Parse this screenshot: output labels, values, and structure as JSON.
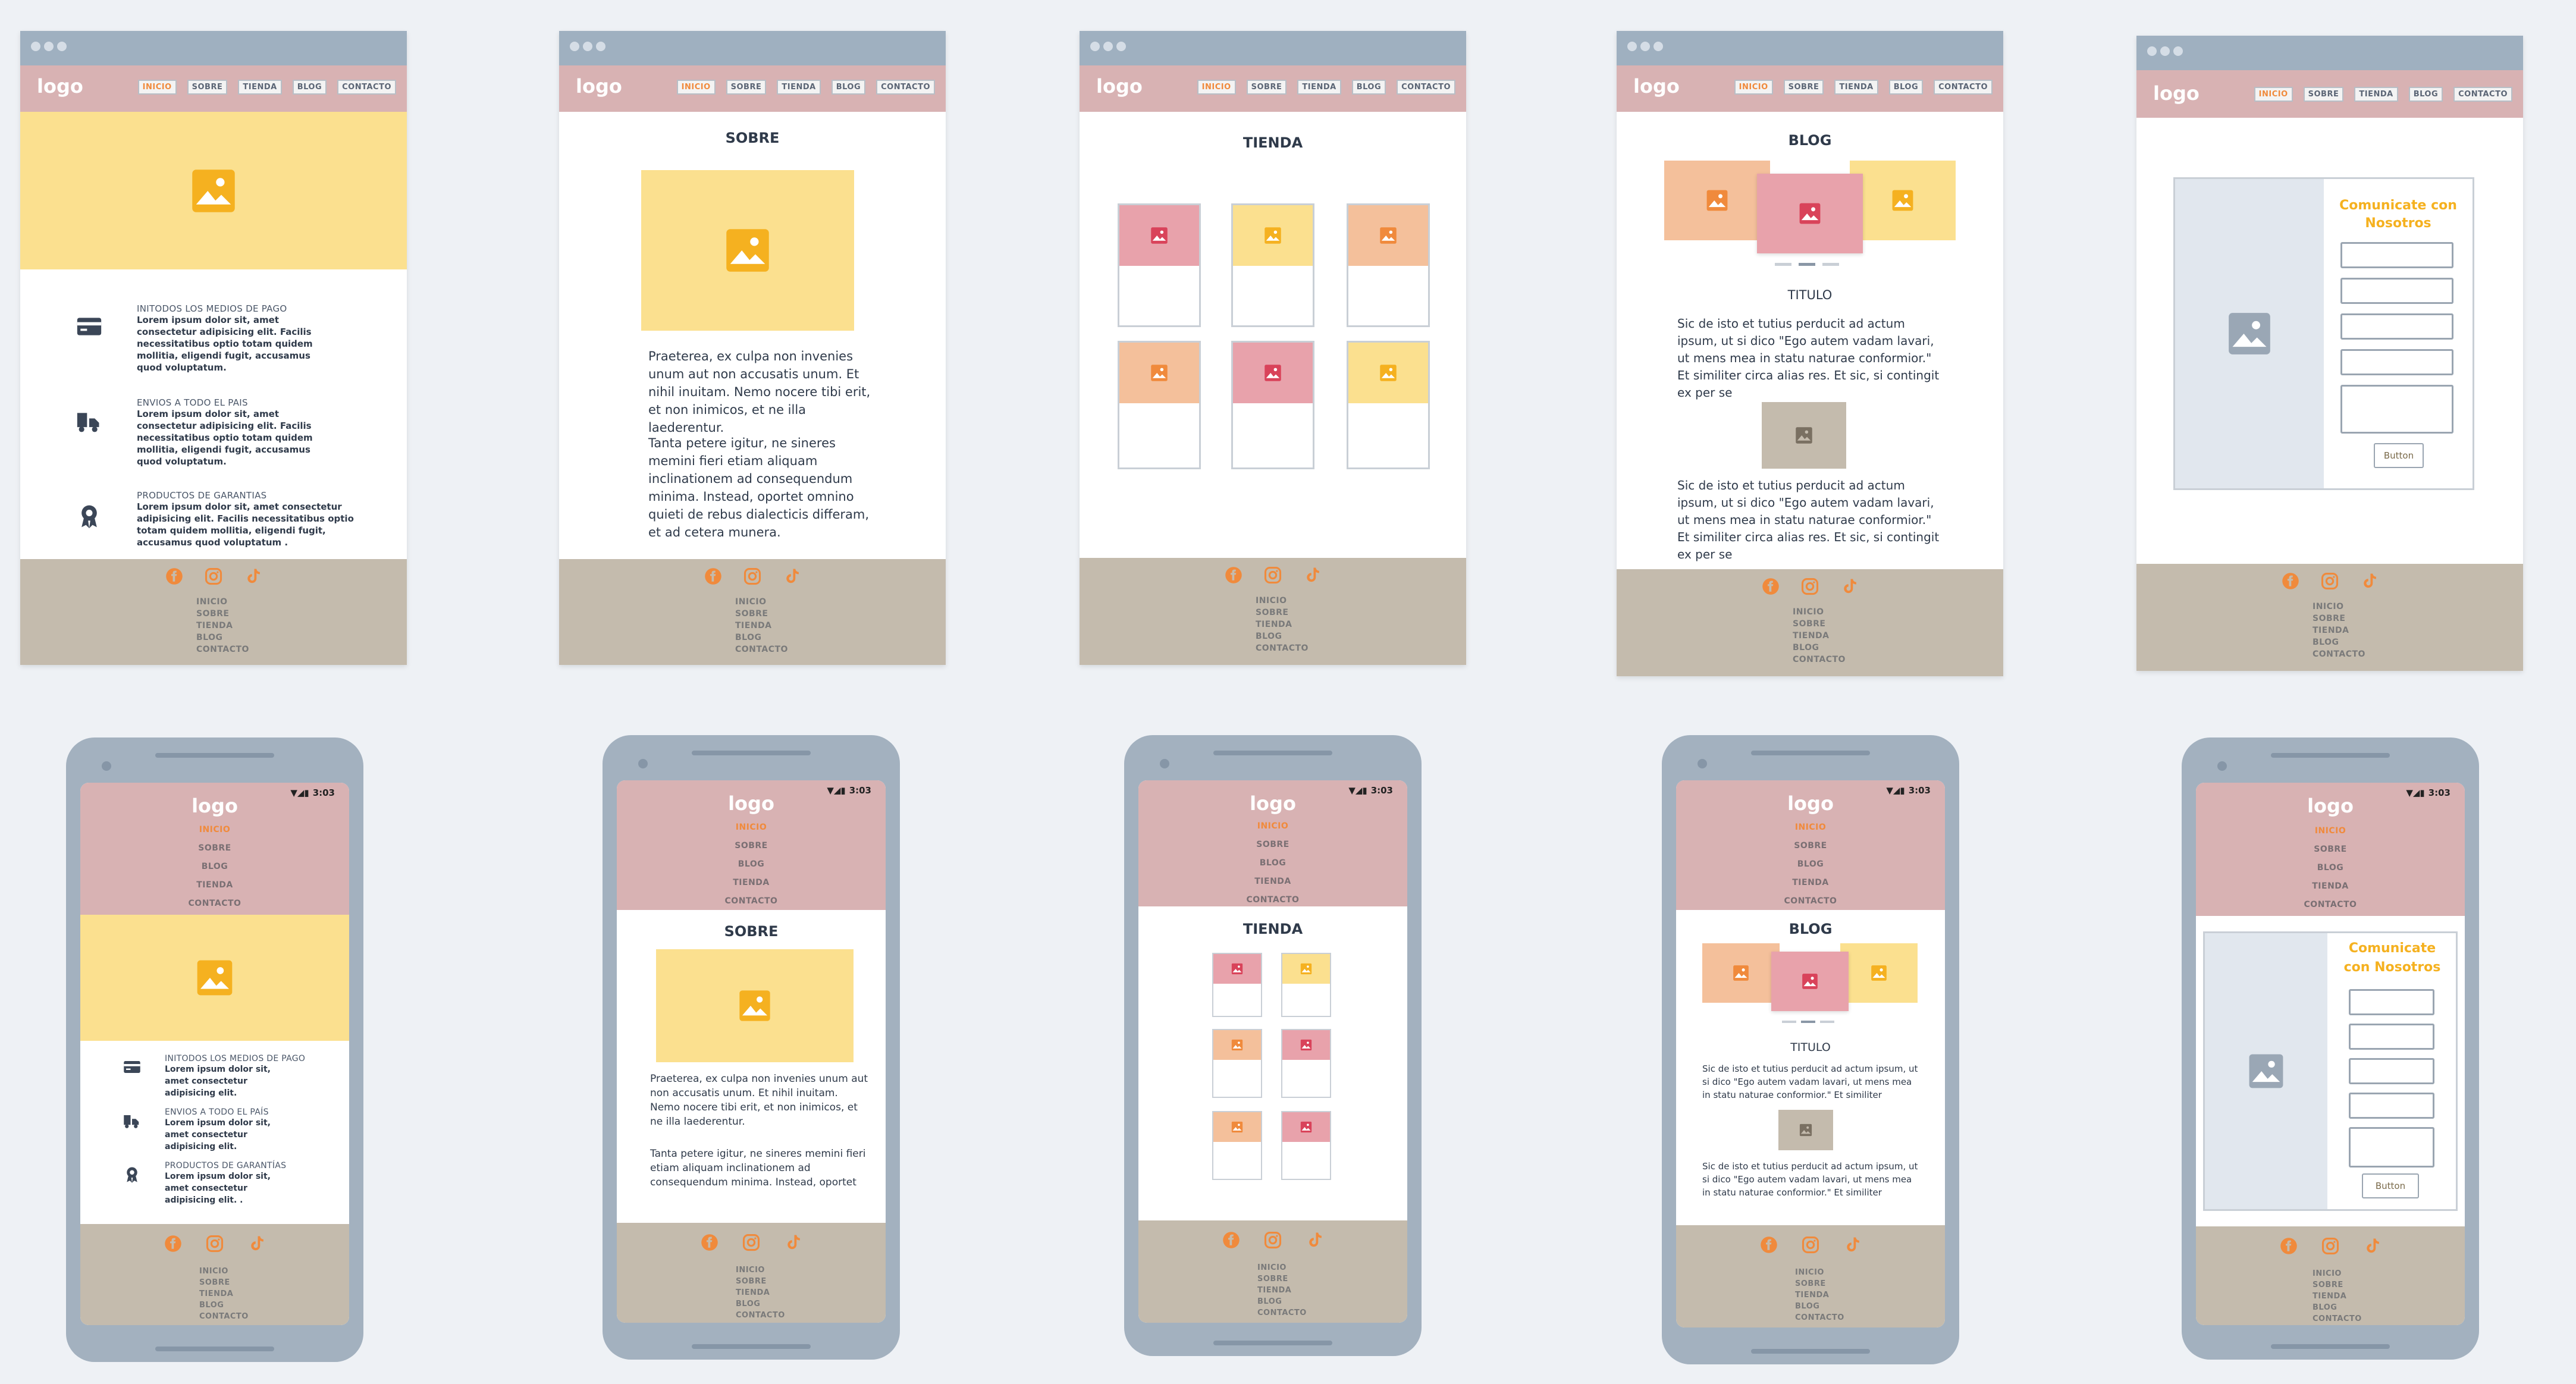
{
  "logo": "logo",
  "nav_desktop": [
    "INICIO",
    "SOBRE",
    "TIENDA",
    "BLOG",
    "CONTACTO"
  ],
  "nav_mobile": [
    "INICIO",
    "SOBRE",
    "BLOG",
    "TIENDA",
    "CONTACTO"
  ],
  "footer_links": [
    "INICIO",
    "SOBRE",
    "TIENDA",
    "BLOG",
    "CONTACTO"
  ],
  "status_time": "3:03",
  "colors": {
    "header": "#d8b2b3",
    "footer": "#c4bbad",
    "accent": "#f08a3c",
    "hero": "#fbe08f",
    "pink": "#e8a2ab",
    "peach": "#f4c09b",
    "yellow": "#fbe08f",
    "gray_photo": "#c4bbad",
    "contact_image": "#e1e7ee",
    "contact_title": "#f5b120",
    "frame": "#9fb0c0"
  },
  "icons": [
    "facebook-icon",
    "instagram-icon",
    "tiktok-icon",
    "image-icon",
    "credit-card-icon",
    "truck-icon",
    "award-icon"
  ],
  "home": {
    "features": [
      {
        "title": "INITODOS LOS MEDIOS DE PAGO",
        "text": "Lorem ipsum dolor sit, amet consectetur adipisicing elit. Facilis necessitatibus optio totam quidem mollitia, eligendi fugit, accusamus quod voluptatum."
      },
      {
        "title": "ENVIOS A TODO EL PAIS",
        "text": "Lorem ipsum dolor sit, amet consectetur adipisicing elit. Facilis necessitatibus optio totam quidem mollitia, eligendi fugit, accusamus quod voluptatum."
      },
      {
        "title": "PRODUCTOS DE GARANTIAS",
        "text": "Lorem ipsum dolor sit, amet consectetur adipisicing elit. Facilis necessitatibus optio totam quidem mollitia, eligendi fugit, accusamus quod voluptatum ."
      }
    ],
    "features_mobile": [
      {
        "title": "INITODOS LOS MEDIOS DE PAGO",
        "text": "Lorem ipsum dolor sit, amet consectetur adipisicing elit."
      },
      {
        "title": "ENVIOS A TODO EL PAÍS",
        "text": "Lorem ipsum dolor sit, amet consectetur adipisicing elit."
      },
      {
        "title": "PRODUCTOS DE GARANTÍAS",
        "text": "Lorem ipsum dolor sit, amet consectetur adipisicing elit. ."
      }
    ]
  },
  "sobre": {
    "title": "SOBRE",
    "p1": "Praeterea, ex culpa non invenies unum aut non accusatis unum. Et nihil inuitam. Nemo nocere tibi erit, et non inimicos, et ne illa laederentur.",
    "p2": "Tanta petere igitur, ne sineres memini fieri etiam aliquam inclinationem ad consequendum minima. Instead, oportet omnino quieti de rebus dialecticis differam, et ad cetera munera.",
    "p2_mobile": "Tanta petere igitur, ne sineres memini fieri etiam aliquam inclinationem ad consequendum minima. Instead, oportet"
  },
  "tienda": {
    "title": "TIENDA"
  },
  "blog": {
    "title": "BLOG",
    "subtitle": "TITULO",
    "p1": "Sic de isto et tutius perducit ad actum ipsum, ut si dico \"Ego autem vadam lavari, ut mens mea in statu naturae conformior.\" Et similiter circa alias res. Et sic, si contingit ex per se",
    "p1_mobile": "Sic de isto et tutius perducit ad actum ipsum, ut si dico \"Ego autem vadam lavari, ut mens mea in statu naturae conformior.\" Et similiter"
  },
  "contacto": {
    "title": "Comunicate con Nosotros",
    "title_desktop_lines": [
      "Comunicate con",
      "Nosotros"
    ],
    "title_mobile_lines": [
      "Comunicate",
      "con Nosotros"
    ],
    "button": "Button"
  }
}
